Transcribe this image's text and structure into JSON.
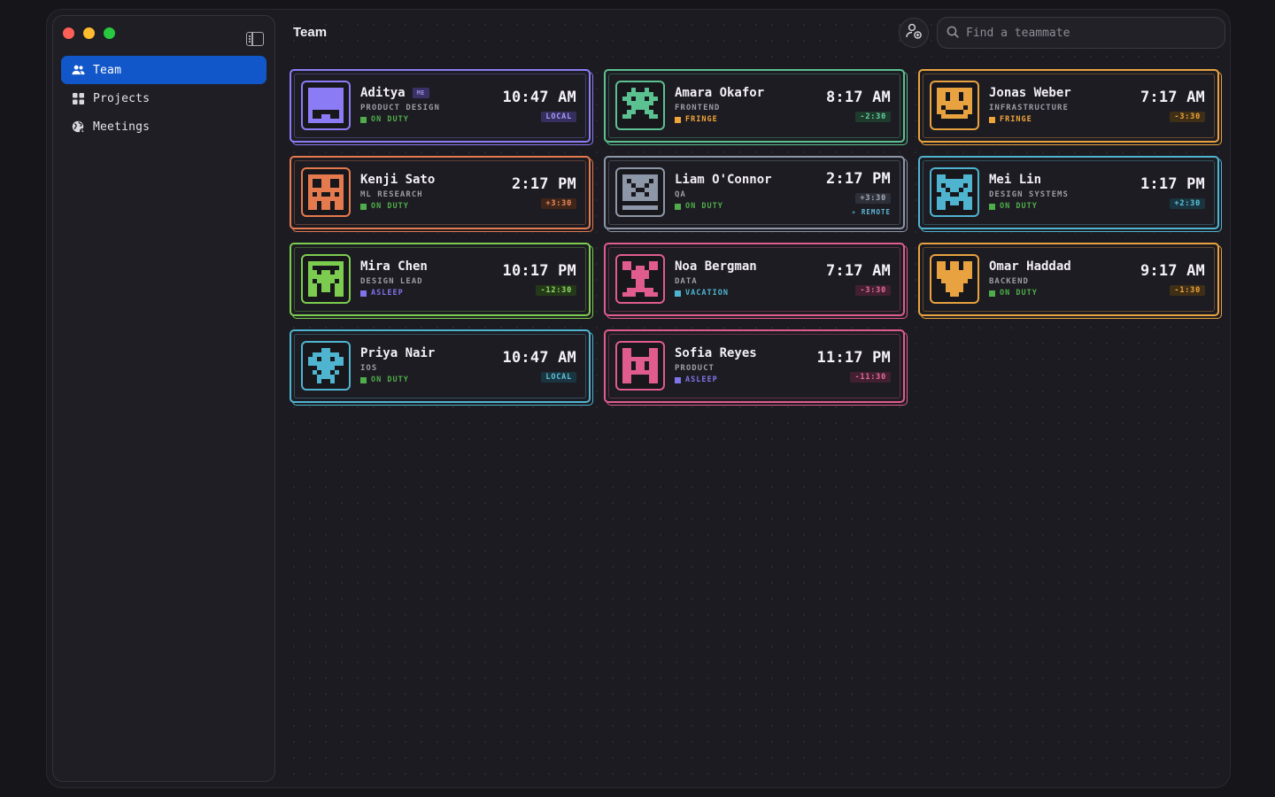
{
  "sidebar": {
    "items": [
      {
        "label": "Team",
        "icon": "people-icon",
        "active": true
      },
      {
        "label": "Projects",
        "icon": "grid-icon",
        "active": false
      },
      {
        "label": "Meetings",
        "icon": "globe-icon",
        "active": false
      }
    ]
  },
  "header": {
    "title": "Team",
    "search_placeholder": "Find a teammate"
  },
  "me_tag": "ME",
  "members": [
    {
      "name": "Aditya",
      "role": "PRODUCT DESIGN",
      "status": "ON DUTY",
      "status_color": "#4fae4a",
      "time": "10:47 AM",
      "offset": "LOCAL",
      "offset_fg": "#a79cff",
      "offset_bg": "#342f5c",
      "color": "#8b7cf6",
      "avatar": "purple-face-icon",
      "me": true
    },
    {
      "name": "Amara Okafor",
      "role": "FRONTEND",
      "status": "FRINGE",
      "status_color": "#f0a53a",
      "time": "8:17 AM",
      "offset": "-2:30",
      "offset_fg": "#66d19e",
      "offset_bg": "#1e3b2e",
      "color": "#5cc191",
      "avatar": "green-face-icon"
    },
    {
      "name": "Jonas Weber",
      "role": "INFRASTRUCTURE",
      "status": "FRINGE",
      "status_color": "#f0a53a",
      "time": "7:17 AM",
      "offset": "-3:30",
      "offset_fg": "#f0a53a",
      "offset_bg": "#3f2f17",
      "color": "#e8a23f",
      "avatar": "orange-face-icon"
    },
    {
      "name": "Kenji Sato",
      "role": "ML RESEARCH",
      "status": "ON DUTY",
      "status_color": "#4fae4a",
      "time": "2:17 PM",
      "offset": "+3:30",
      "offset_fg": "#f08a5d",
      "offset_bg": "#40261a",
      "color": "#e57a4f",
      "avatar": "coral-face-icon"
    },
    {
      "name": "Liam O'Connor",
      "role": "QA",
      "status": "ON DUTY",
      "status_color": "#4fae4a",
      "time": "2:17 PM",
      "offset": "+3:30",
      "offset_fg": "#a5adbb",
      "offset_bg": "#2d3038",
      "color": "#8d97a8",
      "avatar": "gray-face-icon",
      "remote": "REMOTE"
    },
    {
      "name": "Mei Lin",
      "role": "DESIGN SYSTEMS",
      "status": "ON DUTY",
      "status_color": "#4fae4a",
      "time": "1:17 PM",
      "offset": "+2:30",
      "offset_fg": "#5fc3dd",
      "offset_bg": "#1a3540",
      "color": "#4fb4d0",
      "avatar": "cyan-face-icon"
    },
    {
      "name": "Mira Chen",
      "role": "DESIGN LEAD",
      "status": "ASLEEP",
      "status_color": "#7f74e8",
      "time": "10:17 PM",
      "offset": "-12:30",
      "offset_fg": "#8fdc5e",
      "offset_bg": "#24391a",
      "color": "#7ccd4f",
      "avatar": "lime-face-icon"
    },
    {
      "name": "Noa Bergman",
      "role": "DATA",
      "status": "VACATION",
      "status_color": "#4fb4d0",
      "time": "7:17 AM",
      "offset": "-3:30",
      "offset_fg": "#ea6a9a",
      "offset_bg": "#402031",
      "color": "#e05c8e",
      "avatar": "pink-face-icon"
    },
    {
      "name": "Omar Haddad",
      "role": "BACKEND",
      "status": "ON DUTY",
      "status_color": "#4fae4a",
      "time": "9:17 AM",
      "offset": "-1:30",
      "offset_fg": "#f0a53a",
      "offset_bg": "#3f2f17",
      "color": "#e8a23f",
      "avatar": "gold-face-icon"
    },
    {
      "name": "Priya Nair",
      "role": "IOS",
      "status": "ON DUTY",
      "status_color": "#4fae4a",
      "time": "10:47 AM",
      "offset": "LOCAL",
      "offset_fg": "#5fc3dd",
      "offset_bg": "#1a3540",
      "color": "#4fb4d0",
      "avatar": "teal-face-icon"
    },
    {
      "name": "Sofia Reyes",
      "role": "PRODUCT",
      "status": "ASLEEP",
      "status_color": "#7f74e8",
      "time": "11:17 PM",
      "offset": "-11:30",
      "offset_fg": "#ea6a9a",
      "offset_bg": "#402031",
      "color": "#e05c8e",
      "avatar": "rose-face-icon"
    }
  ]
}
